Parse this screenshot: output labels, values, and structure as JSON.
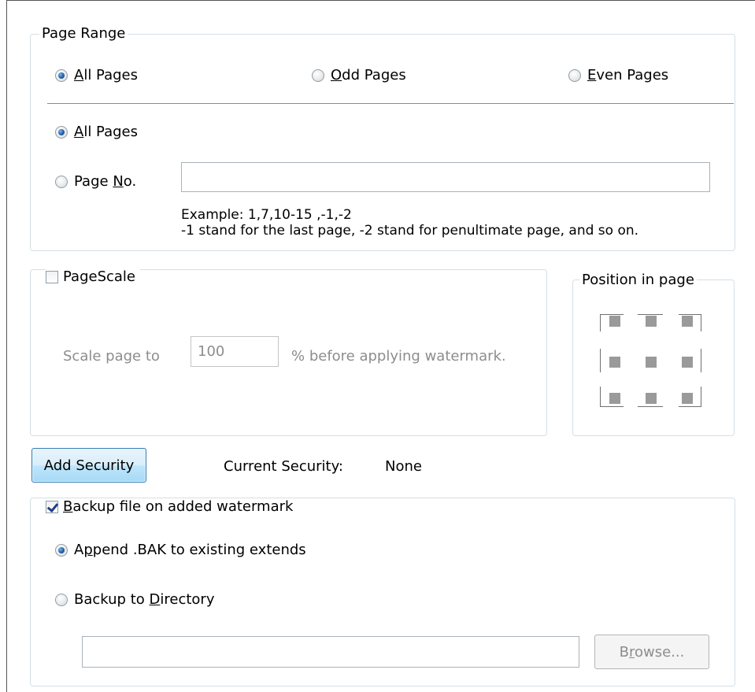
{
  "page_range": {
    "legend": "Page Range",
    "parity": [
      {
        "prefix": "",
        "accel": "A",
        "rest": "ll Pages",
        "selected": true
      },
      {
        "prefix": "",
        "accel": "O",
        "rest": "dd Pages",
        "selected": false
      },
      {
        "prefix": "",
        "accel": "E",
        "rest": "ven Pages",
        "selected": false
      }
    ],
    "scope_all": {
      "prefix": "",
      "accel": "A",
      "rest": "ll Pages",
      "selected": true
    },
    "scope_page": {
      "prefix": "Page ",
      "accel": "N",
      "rest": "o.",
      "selected": false
    },
    "page_no_value": "",
    "example_line1": "Example: 1,7,10-15 ,-1,-2",
    "example_line2": "-1 stand for the last page, -2 stand for penultimate page, and so on."
  },
  "page_scale": {
    "label": "PageScale",
    "checked": false,
    "scale_label": "Scale page to",
    "scale_value": "100",
    "scale_suffix": "% before applying watermark."
  },
  "position": {
    "legend": "Position in page"
  },
  "security": {
    "button_label": "Add Security",
    "current_label": "Current Security:",
    "current_value": "None"
  },
  "backup": {
    "checkbox": {
      "prefix": "",
      "accel": "B",
      "rest": "ackup file on added watermark",
      "checked": true
    },
    "append": {
      "prefix": "A",
      "accel": "p",
      "rest": "pend .BAK to existing extends",
      "selected": true
    },
    "directory": {
      "prefix": "Backup to ",
      "accel": "D",
      "rest": "irectory",
      "selected": false
    },
    "directory_value": "",
    "browse": {
      "prefix": "B",
      "accel": "r",
      "rest": "owse..."
    }
  }
}
